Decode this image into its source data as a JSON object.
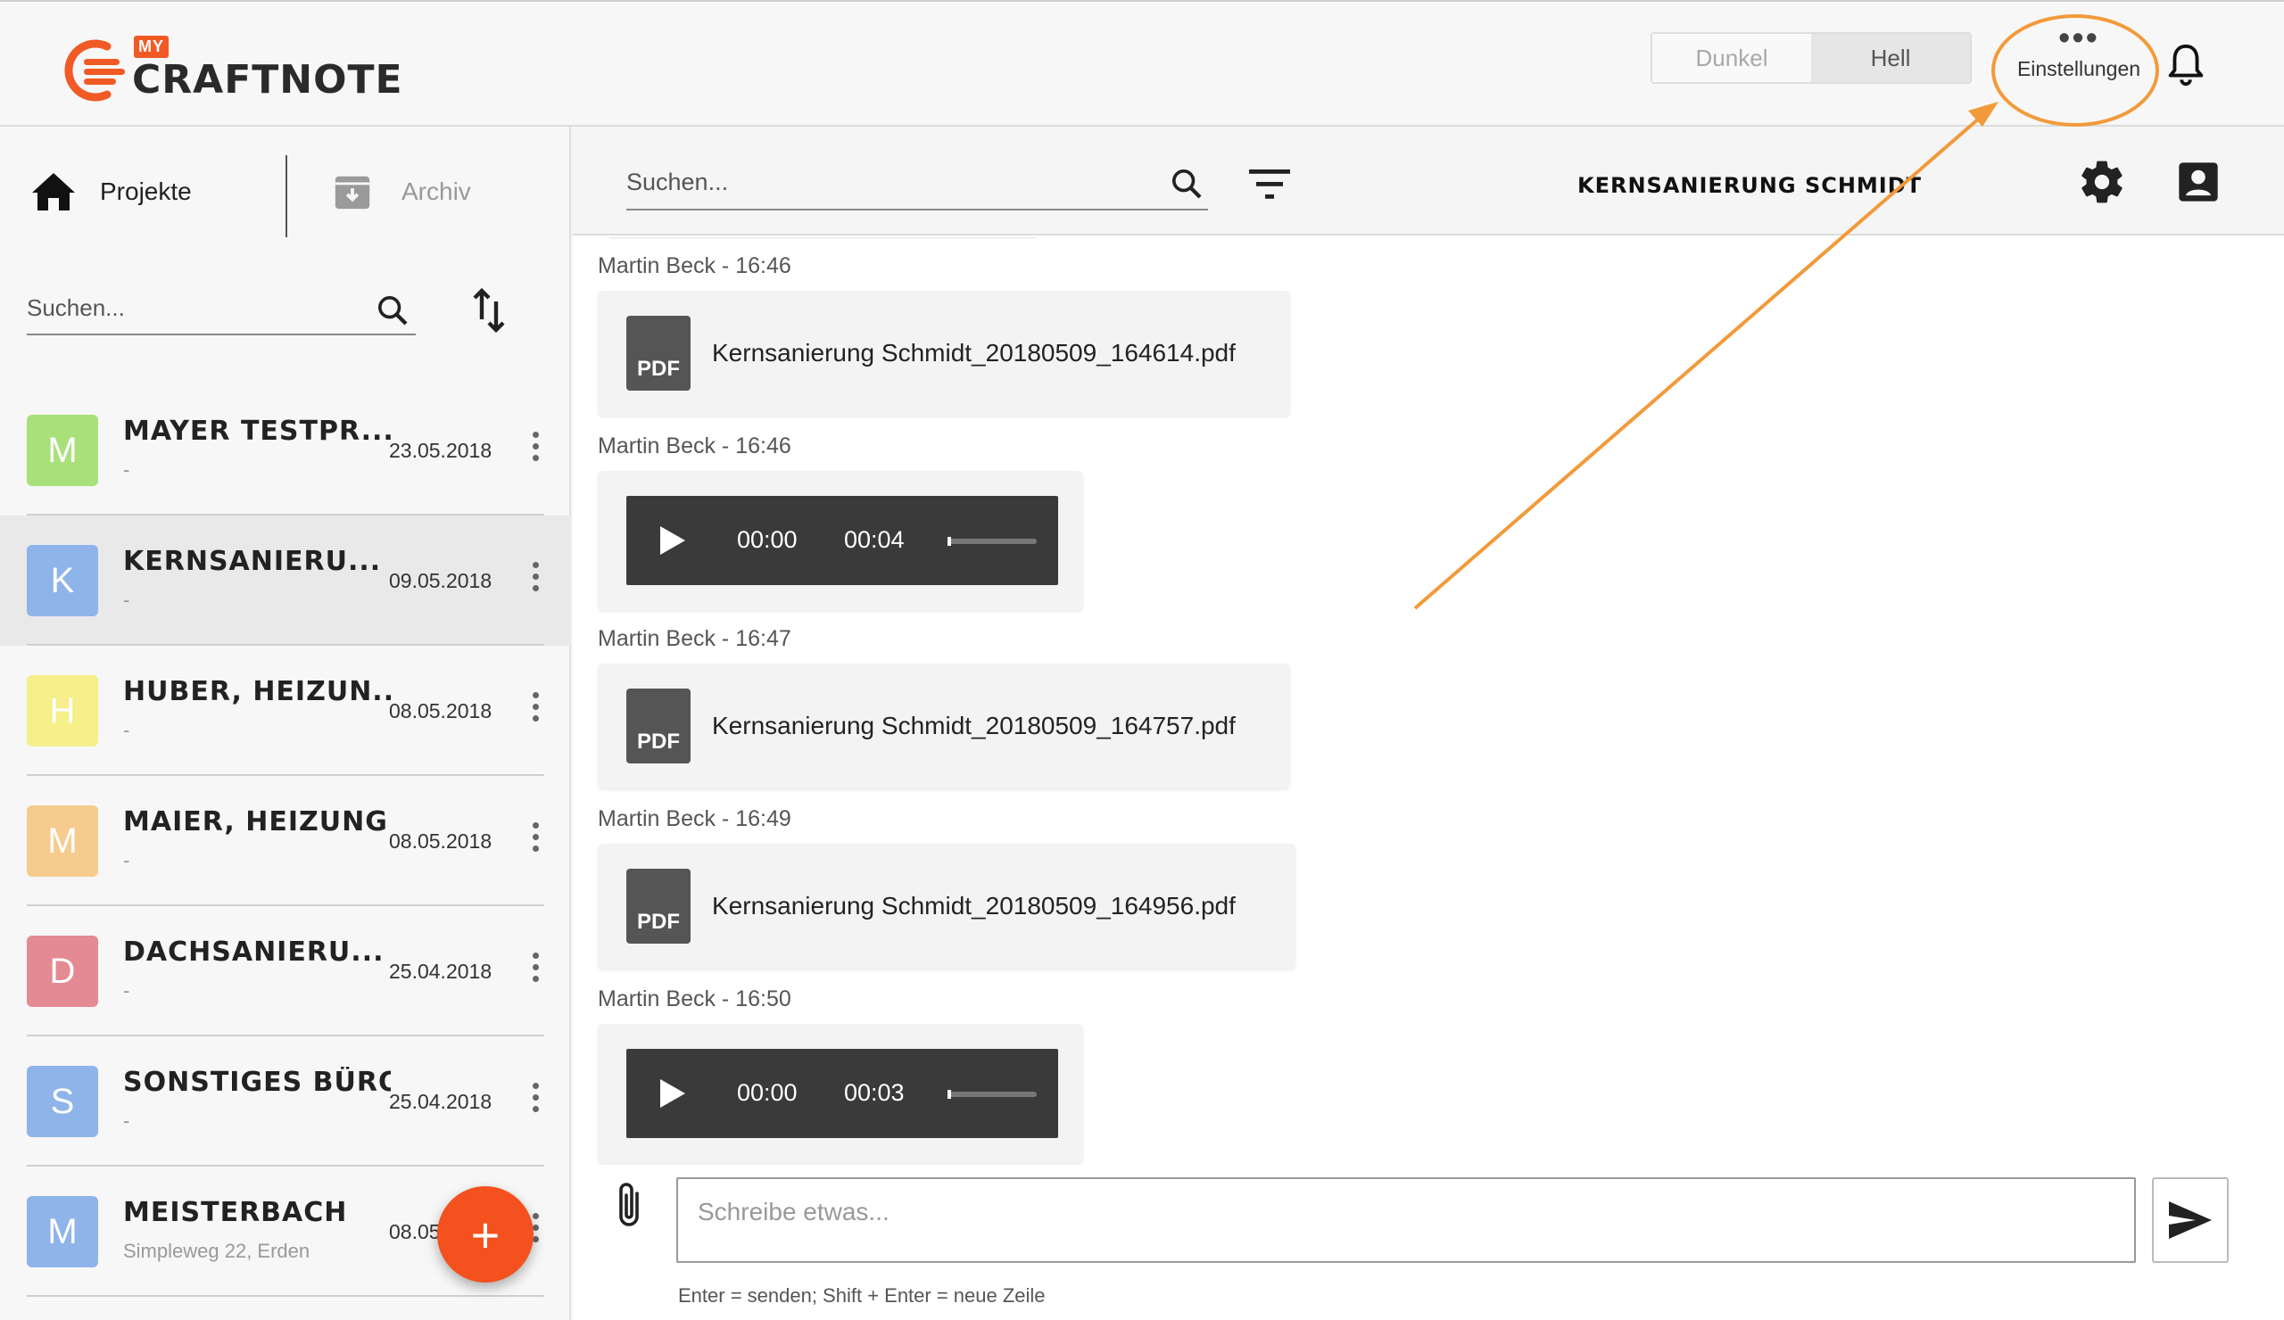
{
  "app": {
    "logo_my": "MY",
    "logo_name": "CRAFTNOTE"
  },
  "header": {
    "theme_dark_label": "Dunkel",
    "theme_light_label": "Hell",
    "settings_label": "Einstellungen",
    "active_theme": "Hell",
    "annotation_color": "#f29a3a"
  },
  "sidebar": {
    "tab_projects": "Projekte",
    "tab_archive": "Archiv",
    "search_placeholder": "Suchen...",
    "projects": [
      {
        "initial": "M",
        "name": "MAYER TESTPR...",
        "subtitle": "-",
        "date": "23.05.2018",
        "color": "#a8e07a",
        "active": false
      },
      {
        "initial": "K",
        "name": "KERNSANIERU...",
        "subtitle": "-",
        "date": "09.05.2018",
        "color": "#8fb4ea",
        "active": true
      },
      {
        "initial": "H",
        "name": "HUBER, HEIZUN...",
        "subtitle": "-",
        "date": "08.05.2018",
        "color": "#f6ef8a",
        "active": false
      },
      {
        "initial": "M",
        "name": "MAIER, HEIZUNG",
        "subtitle": "-",
        "date": "08.05.2018",
        "color": "#f6cb8e",
        "active": false
      },
      {
        "initial": "D",
        "name": "DACHSANIERU...",
        "subtitle": "-",
        "date": "25.04.2018",
        "color": "#e48a93",
        "active": false
      },
      {
        "initial": "S",
        "name": "SONSTIGES BÜRO",
        "subtitle": "-",
        "date": "25.04.2018",
        "color": "#8fb4ea",
        "active": false
      },
      {
        "initial": "M",
        "name": "MEISTERBACH",
        "subtitle": "Simpleweg 22, Erden",
        "date": "08.05.2018",
        "color": "#8fb4ea",
        "active": false
      }
    ],
    "fab_label": "+"
  },
  "chat": {
    "search_placeholder": "Suchen...",
    "title": "KERNSANIERUNG SCHMIDT",
    "messages": [
      {
        "meta": "Martin Beck - 16:46",
        "type": "pdf",
        "badge": "PDF",
        "filename": "Kernsanierung Schmidt_20180509_164614.pdf"
      },
      {
        "meta": "Martin Beck - 16:46",
        "type": "audio",
        "current": "00:00",
        "duration": "00:04"
      },
      {
        "meta": "Martin Beck - 16:47",
        "type": "pdf",
        "badge": "PDF",
        "filename": "Kernsanierung Schmidt_20180509_164757.pdf"
      },
      {
        "meta": "Martin Beck - 16:49",
        "type": "pdf",
        "badge": "PDF",
        "filename": "Kernsanierung Schmidt_20180509_164956.pdf"
      },
      {
        "meta": "Martin Beck - 16:50",
        "type": "audio",
        "current": "00:00",
        "duration": "00:03"
      }
    ],
    "composer_placeholder": "Schreibe etwas...",
    "hint": "Enter = senden; Shift + Enter = neue Zeile"
  }
}
